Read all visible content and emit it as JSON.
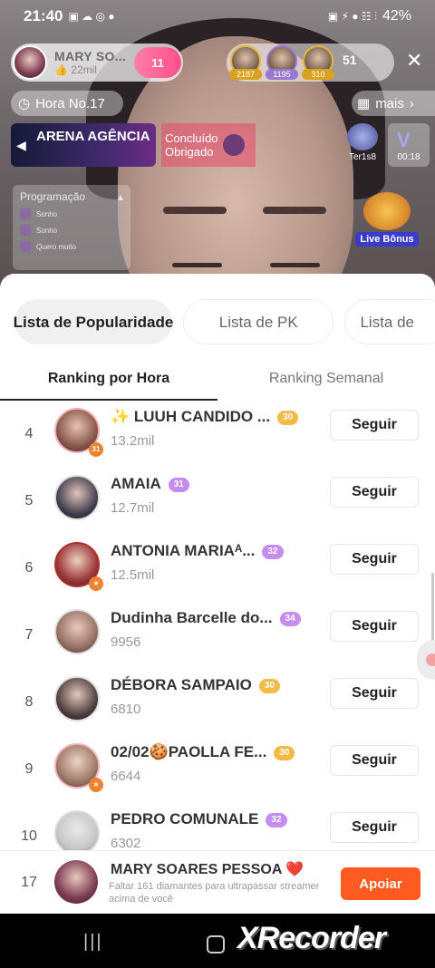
{
  "status_bar": {
    "time": "21:40",
    "left_icons": "▣ ☁ ◎ ●",
    "right_icons": "▣ ⚡ ● ☷ ⫶",
    "battery": "42%"
  },
  "stream": {
    "host_name": "MARY SO...",
    "host_followers": "22mil",
    "host_heart_count": "11",
    "top_gifters": [
      {
        "value": "2187",
        "color": "#d8a21f"
      },
      {
        "value": "1195",
        "color": "#9a78d0"
      },
      {
        "value": "310",
        "color": "#d8a21f"
      }
    ],
    "viewer_count": "51",
    "hour_label": "Hora No.17",
    "more_label": "mais",
    "arena_label": "ARENA AGÊNCIA",
    "mission_label": "Concluído Obrigado",
    "ter_label": "Ter1s8",
    "timer_label": "00:18",
    "program_title": "Programação",
    "program_items": [
      "Sonho",
      "Sonho",
      "Quero muito"
    ],
    "live_bonus": "Live Bônus"
  },
  "sheet": {
    "tabs": [
      "Lista de Popularidade",
      "Lista de PK",
      "Lista de"
    ],
    "subtabs": [
      "Ranking por Hora",
      "Ranking Semanal"
    ],
    "follow_label": "Seguir",
    "rows": [
      {
        "rank": "4",
        "name": "✨ LUUH CANDIDO ...",
        "level": "30",
        "level_color": "#f5b945",
        "score": "13.2mil",
        "avatar_color": "#8b5a4e"
      },
      {
        "rank": "5",
        "name": "AMAIA",
        "level": "31",
        "level_color": "#c78cf0",
        "score": "12.7mil",
        "avatar_color": "#3d3a4a"
      },
      {
        "rank": "6",
        "name": "ANTONIA MARIAᴬ...",
        "level": "32",
        "level_color": "#c78cf0",
        "score": "12.5mil",
        "avatar_color": "#9e3b3b"
      },
      {
        "rank": "7",
        "name": "Dudinha Barcelle do...",
        "level": "34",
        "level_color": "#c78cf0",
        "score": "9956",
        "avatar_color": "#9a7266"
      },
      {
        "rank": "8",
        "name": "DÉBORA SAMPAIO",
        "level": "30",
        "level_color": "#f5b945",
        "score": "6810",
        "avatar_color": "#4a3a3a"
      },
      {
        "rank": "9",
        "name": "02/02🍪PAOLLA FE...",
        "level": "30",
        "level_color": "#f5b945",
        "score": "6644",
        "avatar_color": "#a07b6a"
      },
      {
        "rank": "10",
        "name": "PEDRO COMUNALE",
        "level": "32",
        "level_color": "#c78cf0",
        "score": "6302",
        "avatar_color": "#c8c8c8"
      }
    ],
    "me": {
      "rank": "17",
      "name": "MARY SOARES PESSOA ❤️",
      "hint": "Faltar 161 diamantes para ultrapassar streamer acima de você",
      "button": "Apoiar"
    }
  },
  "nav": {
    "recent": "|||",
    "watermark": "XRecorder"
  }
}
